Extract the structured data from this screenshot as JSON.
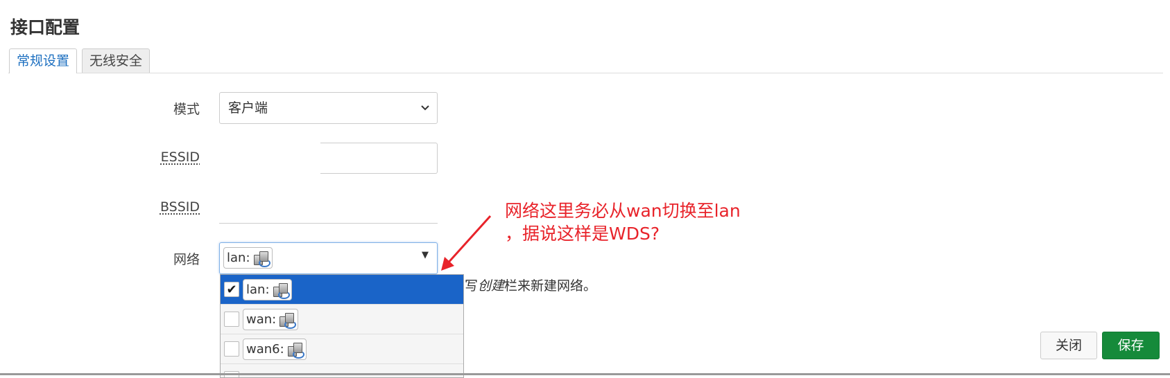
{
  "dialog": {
    "title": "接口配置"
  },
  "tabs": [
    {
      "label": "常规设置",
      "active": true
    },
    {
      "label": "无线安全",
      "active": false
    }
  ],
  "form": {
    "mode": {
      "label": "模式",
      "value": "客户端"
    },
    "essid": {
      "label": "ESSID",
      "value": ""
    },
    "bssid": {
      "label": "BSSID",
      "value": ""
    },
    "network": {
      "label": "网络",
      "value": "lan:",
      "value_icon": "network-interface-icon",
      "options": [
        {
          "label": "lan:",
          "checked": true,
          "icon": "network-interface-icon"
        },
        {
          "label": "wan:",
          "checked": false,
          "icon": "network-interface-icon"
        },
        {
          "label": "wan6:",
          "checked": false,
          "icon": "network-interface-icon"
        }
      ],
      "help_prefix": "写",
      "help_em": "创建",
      "help_suffix": "栏来新建网络。"
    }
  },
  "annotation": {
    "line1": "网络这里务必从wan切换至lan",
    "line2": "，据说这样是WDS?",
    "color": "#e8232a"
  },
  "buttons": {
    "close": "关闭",
    "save": "保存"
  },
  "colors": {
    "accent": "#1a64c8",
    "save": "#158a3a"
  }
}
